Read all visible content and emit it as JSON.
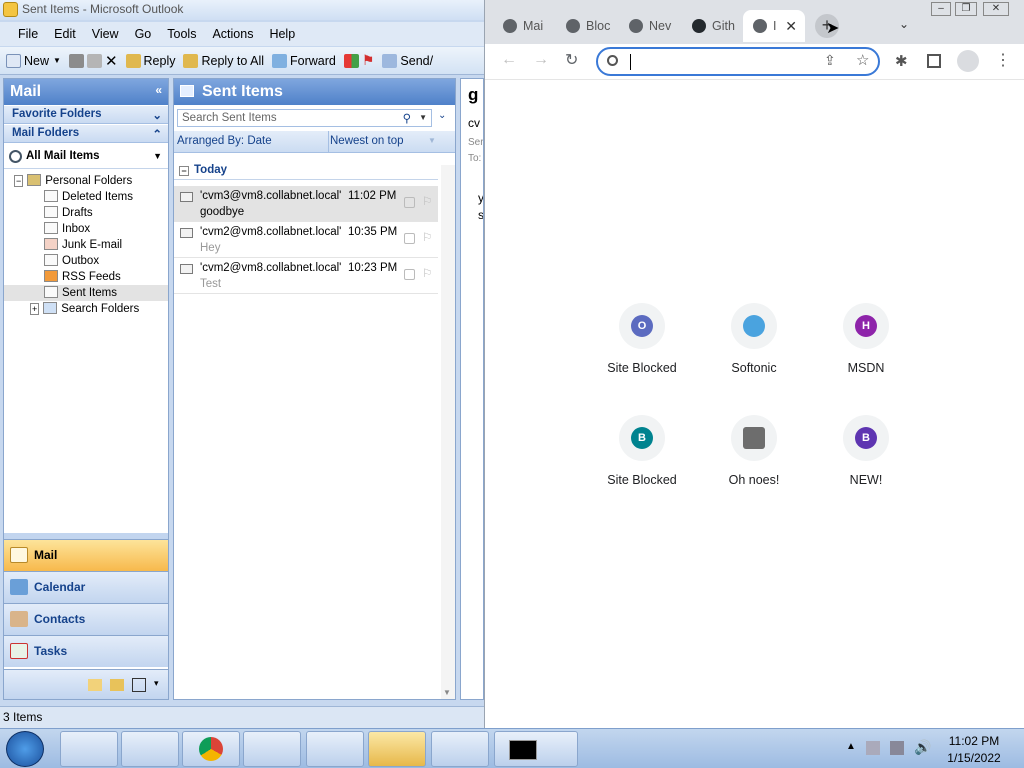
{
  "outlook": {
    "title": "Sent Items - Microsoft Outlook",
    "menu": [
      "File",
      "Edit",
      "View",
      "Go",
      "Tools",
      "Actions",
      "Help"
    ],
    "toolbar": {
      "new": "New",
      "reply": "Reply",
      "reply_all": "Reply to All",
      "forward": "Forward",
      "send": "Send/"
    },
    "nav": {
      "header": "Mail",
      "favorite_folders": "Favorite Folders",
      "mail_folders": "Mail Folders",
      "all_mail_items": "All Mail Items",
      "folders": [
        "Personal Folders",
        "Deleted Items",
        "Drafts",
        "Inbox",
        "Junk E-mail",
        "Outbox",
        "RSS Feeds",
        "Sent Items",
        "Search Folders"
      ],
      "buttons": [
        "Mail",
        "Calendar",
        "Contacts",
        "Tasks"
      ]
    },
    "list": {
      "header": "Sent Items",
      "search_placeholder": "Search Sent Items",
      "arranged_by": "Arranged By: Date",
      "sort_order": "Newest on top",
      "group": "Today",
      "items": [
        {
          "from": "'cvm3@vm8.collabnet.local'",
          "time": "11:02 PM",
          "subject": "goodbye"
        },
        {
          "from": "'cvm2@vm8.collabnet.local'",
          "time": "10:35 PM",
          "subject": "Hey"
        },
        {
          "from": "'cvm2@vm8.collabnet.local'",
          "time": "10:23 PM",
          "subject": "Test"
        }
      ]
    },
    "reading": {
      "l1": "g",
      "l2": "cv",
      "l3": "Ser",
      "l4": "To:",
      "l5": "y",
      "l6": "s"
    },
    "status": "3 Items"
  },
  "chrome": {
    "tabs": [
      {
        "label": "Mai"
      },
      {
        "label": "Bloc"
      },
      {
        "label": "Nev"
      },
      {
        "label": "Gith"
      },
      {
        "label": "I"
      }
    ],
    "address_value": "",
    "shortcuts": [
      {
        "label": "Site Blocked",
        "letter": "O",
        "color": "#5c6bc0"
      },
      {
        "label": "Softonic",
        "letter": "",
        "color": "#4aa3df"
      },
      {
        "label": "MSDN",
        "letter": "H",
        "color": "#8e24aa"
      },
      {
        "label": "Site Blocked",
        "letter": "B",
        "color": "#00838f"
      },
      {
        "label": "Oh noes!",
        "letter": "",
        "color": "#6d6d6d"
      },
      {
        "label": "NEW!",
        "letter": "B",
        "color": "#5e35b1"
      }
    ]
  },
  "taskbar": {
    "time": "11:02 PM",
    "date": "1/15/2022"
  }
}
